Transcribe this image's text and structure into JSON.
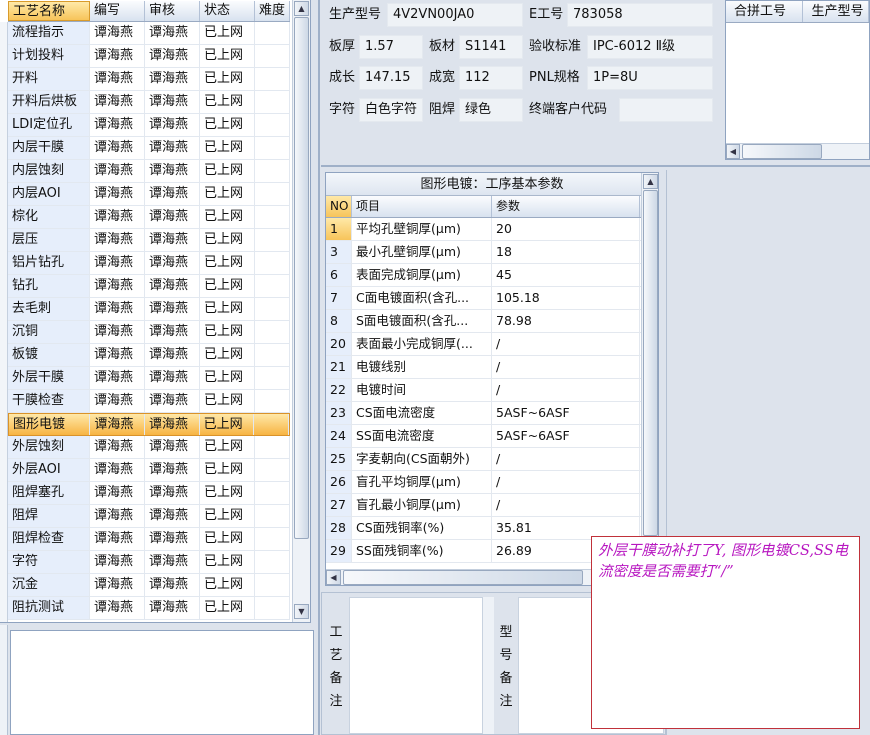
{
  "process_grid": {
    "columns": [
      "工艺名称",
      "编写",
      "审核",
      "状态",
      "难度"
    ],
    "rows": [
      [
        "流程指示",
        "谭海燕",
        "谭海燕",
        "已上网",
        ""
      ],
      [
        "计划投料",
        "谭海燕",
        "谭海燕",
        "已上网",
        ""
      ],
      [
        "开料",
        "谭海燕",
        "谭海燕",
        "已上网",
        ""
      ],
      [
        "开料后烘板",
        "谭海燕",
        "谭海燕",
        "已上网",
        ""
      ],
      [
        "LDI定位孔",
        "谭海燕",
        "谭海燕",
        "已上网",
        ""
      ],
      [
        "内层干膜",
        "谭海燕",
        "谭海燕",
        "已上网",
        ""
      ],
      [
        "内层蚀刻",
        "谭海燕",
        "谭海燕",
        "已上网",
        ""
      ],
      [
        "内层AOI",
        "谭海燕",
        "谭海燕",
        "已上网",
        ""
      ],
      [
        "棕化",
        "谭海燕",
        "谭海燕",
        "已上网",
        ""
      ],
      [
        "层压",
        "谭海燕",
        "谭海燕",
        "已上网",
        ""
      ],
      [
        "铝片钻孔",
        "谭海燕",
        "谭海燕",
        "已上网",
        ""
      ],
      [
        "钻孔",
        "谭海燕",
        "谭海燕",
        "已上网",
        ""
      ],
      [
        "去毛刺",
        "谭海燕",
        "谭海燕",
        "已上网",
        ""
      ],
      [
        "沉铜",
        "谭海燕",
        "谭海燕",
        "已上网",
        ""
      ],
      [
        "板镀",
        "谭海燕",
        "谭海燕",
        "已上网",
        ""
      ],
      [
        "外层干膜",
        "谭海燕",
        "谭海燕",
        "已上网",
        ""
      ],
      [
        "干膜检查",
        "谭海燕",
        "谭海燕",
        "已上网",
        ""
      ],
      [
        "图形电镀",
        "谭海燕",
        "谭海燕",
        "已上网",
        ""
      ],
      [
        "外层蚀刻",
        "谭海燕",
        "谭海燕",
        "已上网",
        ""
      ],
      [
        "外层AOI",
        "谭海燕",
        "谭海燕",
        "已上网",
        ""
      ],
      [
        "阻焊塞孔",
        "谭海燕",
        "谭海燕",
        "已上网",
        ""
      ],
      [
        "阻焊",
        "谭海燕",
        "谭海燕",
        "已上网",
        ""
      ],
      [
        "阻焊检查",
        "谭海燕",
        "谭海燕",
        "已上网",
        ""
      ],
      [
        "字符",
        "谭海燕",
        "谭海燕",
        "已上网",
        ""
      ],
      [
        "沉金",
        "谭海燕",
        "谭海燕",
        "已上网",
        ""
      ],
      [
        "阻抗测试",
        "谭海燕",
        "谭海燕",
        "已上网",
        ""
      ]
    ],
    "selected_row": "图形电镀"
  },
  "info": {
    "model_label": "生产型号",
    "model_value": "4V2VN00JA0",
    "eno_label": "E工号",
    "eno_value": "783058",
    "thickness_label": "板厚",
    "thickness_value": "1.57",
    "material_label": "板材",
    "material_value": "S1141",
    "standard_label": "验收标准",
    "standard_value": "IPC-6012 Ⅱ级",
    "length_label": "成长",
    "length_value": "147.15",
    "width_label": "成宽",
    "width_value": "112",
    "pnl_label": "PNL规格",
    "pnl_value": "1P=8U",
    "char_label": "字符",
    "char_value": "白色字符",
    "mask_label": "阻焊",
    "mask_value": "绿色",
    "customer_label": "终端客户代码",
    "customer_value": ""
  },
  "merge_grid": {
    "columns": [
      "合拼工号",
      "生产型号"
    ]
  },
  "param_grid": {
    "title": "图形电镀：工序基本参数",
    "columns": [
      "NO",
      "项目",
      "参数"
    ],
    "rows": [
      [
        "1",
        "平均孔壁铜厚(μm)",
        "20"
      ],
      [
        "3",
        "最小孔壁铜厚(μm)",
        "18"
      ],
      [
        "6",
        "表面完成铜厚(μm)",
        "45"
      ],
      [
        "7",
        "C面电镀面积(含孔...",
        "105.18"
      ],
      [
        "8",
        "S面电镀面积(含孔...",
        "78.98"
      ],
      [
        "20",
        "表面最小完成铜厚(...",
        "/"
      ],
      [
        "21",
        "电镀线别",
        "/"
      ],
      [
        "22",
        "电镀时间",
        "/"
      ],
      [
        "23",
        "CS面电流密度",
        "5ASF~6ASF"
      ],
      [
        "24",
        "SS面电流密度",
        "5ASF~6ASF"
      ],
      [
        "25",
        "字麦朝向(CS面朝外)",
        "/"
      ],
      [
        "26",
        "盲孔平均铜厚(μm)",
        "/"
      ],
      [
        "27",
        "盲孔最小铜厚(μm)",
        "/"
      ],
      [
        "28",
        "CS面残铜率(%)",
        "35.81"
      ],
      [
        "29",
        "SS面残铜率(%)",
        "26.89"
      ]
    ]
  },
  "memo": {
    "process_memo_label": [
      "工",
      "艺",
      "备",
      "注"
    ],
    "model_memo_label": [
      "型",
      "号",
      "备",
      "注"
    ]
  },
  "annotation": {
    "text": "外层干膜动补打了Y, 图形电镀CS,SS电流密度是否需要打“/”",
    "color": "#b716c0"
  },
  "colors": {
    "selection": "#f7b443",
    "header_bg": "#d8e2ef",
    "panel_bg": "#dde3ec"
  }
}
